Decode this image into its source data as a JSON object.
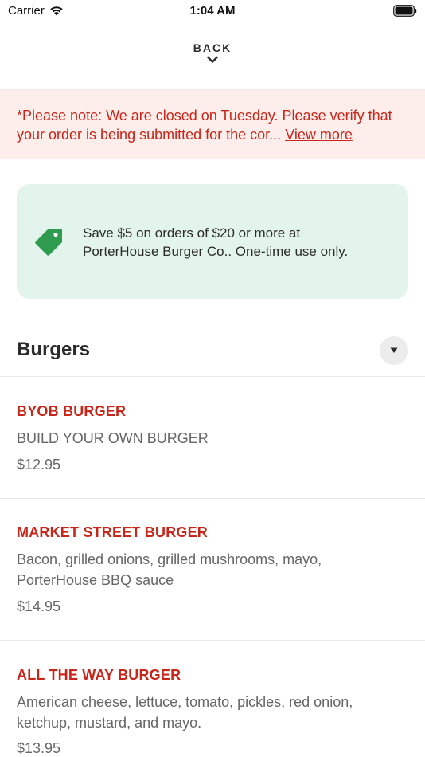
{
  "status_bar": {
    "carrier": "Carrier",
    "time": "1:04 AM"
  },
  "header": {
    "back_label": "BACK"
  },
  "notice": {
    "text": "*Please note: We are closed on Tuesday. Please verify that your order is being submitted for the cor...",
    "link_label": "View more",
    "text_color": "#c8261a",
    "background": "#fdeeec"
  },
  "promo": {
    "line1": "Save $5 on orders of $20 or more at",
    "line2": "PorterHouse Burger Co.. One-time use only.",
    "icon": "tag-icon",
    "icon_color": "#2e9b4f",
    "background": "#e3f4ec"
  },
  "section": {
    "title": "Burgers",
    "toggle_icon": "caret-down-icon"
  },
  "menu_items": [
    {
      "name": "BYOB BURGER",
      "description": "BUILD YOUR OWN BURGER",
      "price": "$12.95"
    },
    {
      "name": "MARKET STREET BURGER",
      "description": "Bacon, grilled onions, grilled mushrooms, mayo, PorterHouse BBQ sauce",
      "price": "$14.95"
    },
    {
      "name": "ALL THE WAY BURGER",
      "description": "American cheese, lettuce, tomato, pickles, red onion, ketchup, mustard, and mayo.",
      "price": "$13.95"
    }
  ]
}
